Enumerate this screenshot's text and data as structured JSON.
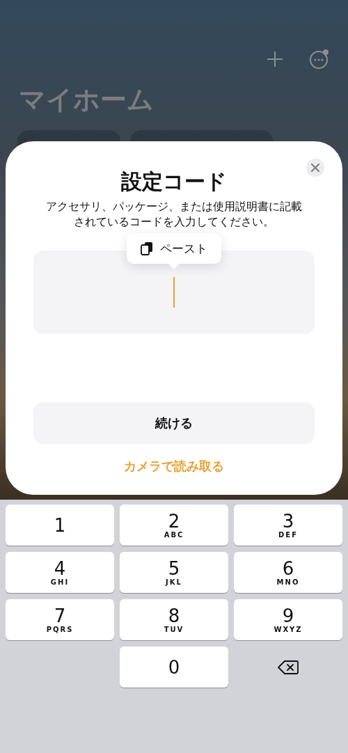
{
  "header": {
    "title": "マイホーム",
    "notification": true
  },
  "sheet": {
    "title": "設定コード",
    "description": "アクセサリ、パッケージ、または使用説明書に記載されているコードを入力してください。",
    "paste_menu": {
      "label": "ペースト"
    },
    "code_field": {
      "focused": true
    },
    "continue_button": "続ける",
    "camera_link": "カメラで読み取る"
  },
  "keyboard": {
    "keys": [
      {
        "kind": "digit",
        "digit": "1"
      },
      {
        "kind": "digit",
        "digit": "2",
        "letters": "ABC"
      },
      {
        "kind": "digit",
        "digit": "3",
        "letters": "DEF"
      },
      {
        "kind": "digit",
        "digit": "4",
        "letters": "GHI"
      },
      {
        "kind": "digit",
        "digit": "5",
        "letters": "JKL"
      },
      {
        "kind": "digit",
        "digit": "6",
        "letters": "MNO"
      },
      {
        "kind": "digit",
        "digit": "7",
        "letters": "PQRS"
      },
      {
        "kind": "digit",
        "digit": "8",
        "letters": "TUV"
      },
      {
        "kind": "digit",
        "digit": "9",
        "letters": "WXYZ"
      },
      {
        "kind": "blank"
      },
      {
        "kind": "digit",
        "digit": "0"
      },
      {
        "kind": "delete"
      }
    ]
  }
}
